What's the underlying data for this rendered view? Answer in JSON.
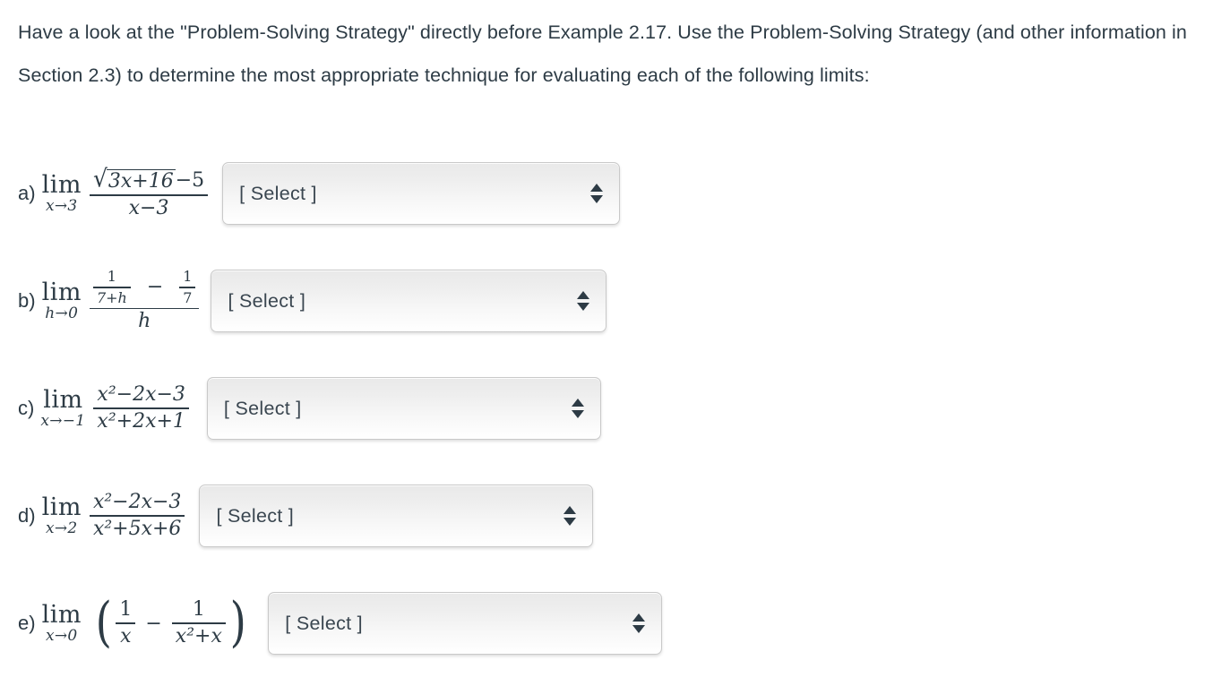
{
  "page": {
    "background_color": "#ffffff",
    "text_color": "#2d3b45"
  },
  "prompt": {
    "text": "Have a look at the \"Problem-Solving Strategy\" directly before Example 2.17. Use the Problem-Solving Strategy (and other information in Section 2.3) to determine the most appropriate technique for evaluating each of the following limits:"
  },
  "questions": [
    {
      "label": "a)",
      "limit_operator": "lim",
      "limit_subscript": "x→3",
      "expression_latex": "\\lim_{x \\to 3} \\frac{\\sqrt{3x+16}-5}{x-3}",
      "numerator": {
        "radicand": "3x+16",
        "after_radical": "−5"
      },
      "denominator": "x−3",
      "select": {
        "value": "[ Select ]",
        "placeholder": "[ Select ]"
      }
    },
    {
      "label": "b)",
      "limit_operator": "lim",
      "limit_subscript": "h→0",
      "expression_latex": "\\lim_{h \\to 0} \\frac{\\frac{1}{7+h}-\\frac{1}{7}}{h}",
      "numerator": {
        "left_fraction": {
          "num": "1",
          "den": "7+h"
        },
        "operator": "−",
        "right_fraction": {
          "num": "1",
          "den": "7"
        }
      },
      "denominator": "h",
      "select": {
        "value": "[ Select ]",
        "placeholder": "[ Select ]"
      }
    },
    {
      "label": "c)",
      "limit_operator": "lim",
      "limit_subscript": "x→−1",
      "expression_latex": "\\lim_{x \\to -1} \\frac{x^2-2x-3}{x^2+2x+1}",
      "numerator": "x²−2x−3",
      "denominator": "x²+2x+1",
      "select": {
        "value": "[ Select ]",
        "placeholder": "[ Select ]"
      }
    },
    {
      "label": "d)",
      "limit_operator": "lim",
      "limit_subscript": "x→2",
      "expression_latex": "\\lim_{x \\to 2} \\frac{x^2-2x-3}{x^2+5x+6}",
      "numerator": "x²−2x−3",
      "denominator": "x²+5x+6",
      "select": {
        "value": "[ Select ]",
        "placeholder": "[ Select ]"
      }
    },
    {
      "label": "e)",
      "limit_operator": "lim",
      "limit_subscript": "x→0",
      "expression_latex": "\\lim_{x \\to 0} \\left( \\frac{1}{x} - \\frac{1}{x^2+x} \\right)",
      "paren_open": "(",
      "paren_close": ")",
      "left_fraction": {
        "num": "1",
        "den": "x"
      },
      "operator": "−",
      "right_fraction": {
        "num": "1",
        "den": "x²+x"
      },
      "select": {
        "value": "[ Select ]",
        "placeholder": "[ Select ]"
      }
    }
  ],
  "glyphs": {
    "radical_sign": "√",
    "minus": "−",
    "arrow_up_icon": "▲",
    "arrow_down_icon": "▼"
  }
}
